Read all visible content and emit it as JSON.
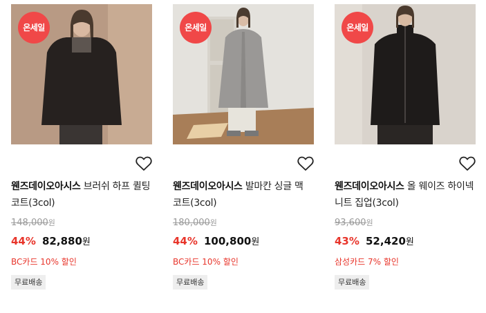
{
  "products": [
    {
      "badge": "온세일",
      "brand": "웬즈데이오아시스",
      "name": "브러쉬 하프 퀼팅 코트(3col)",
      "original_price": "148,000",
      "discount": "44%",
      "price": "82,880",
      "currency": "원",
      "benefit": "BC카드 10% 할인",
      "shipping": "무료배송",
      "image": "model-dark-quilted-coat",
      "image_bg": "#b89a84"
    },
    {
      "badge": "온세일",
      "brand": "웬즈데이오아시스",
      "name": "발마칸 싱글 맥 코트(3col)",
      "original_price": "180,000",
      "discount": "44%",
      "price": "100,800",
      "currency": "원",
      "benefit": "BC카드 10% 할인",
      "shipping": "무료배송",
      "image": "model-grey-mac-coat",
      "image_bg": "#e4e2dd"
    },
    {
      "badge": "온세일",
      "brand": "웬즈데이오아시스",
      "name": "올 웨이즈 하이넥 니트 집업(3col)",
      "original_price": "93,600",
      "discount": "43%",
      "price": "52,420",
      "currency": "원",
      "benefit": "삼성카드 7% 할인",
      "shipping": "무료배송",
      "image": "model-black-knit-zipup",
      "image_bg": "#d9d3cc"
    }
  ],
  "colors": {
    "sale_badge": "#f04848",
    "discount": "#e8352b",
    "benefit": "#e8352b"
  }
}
